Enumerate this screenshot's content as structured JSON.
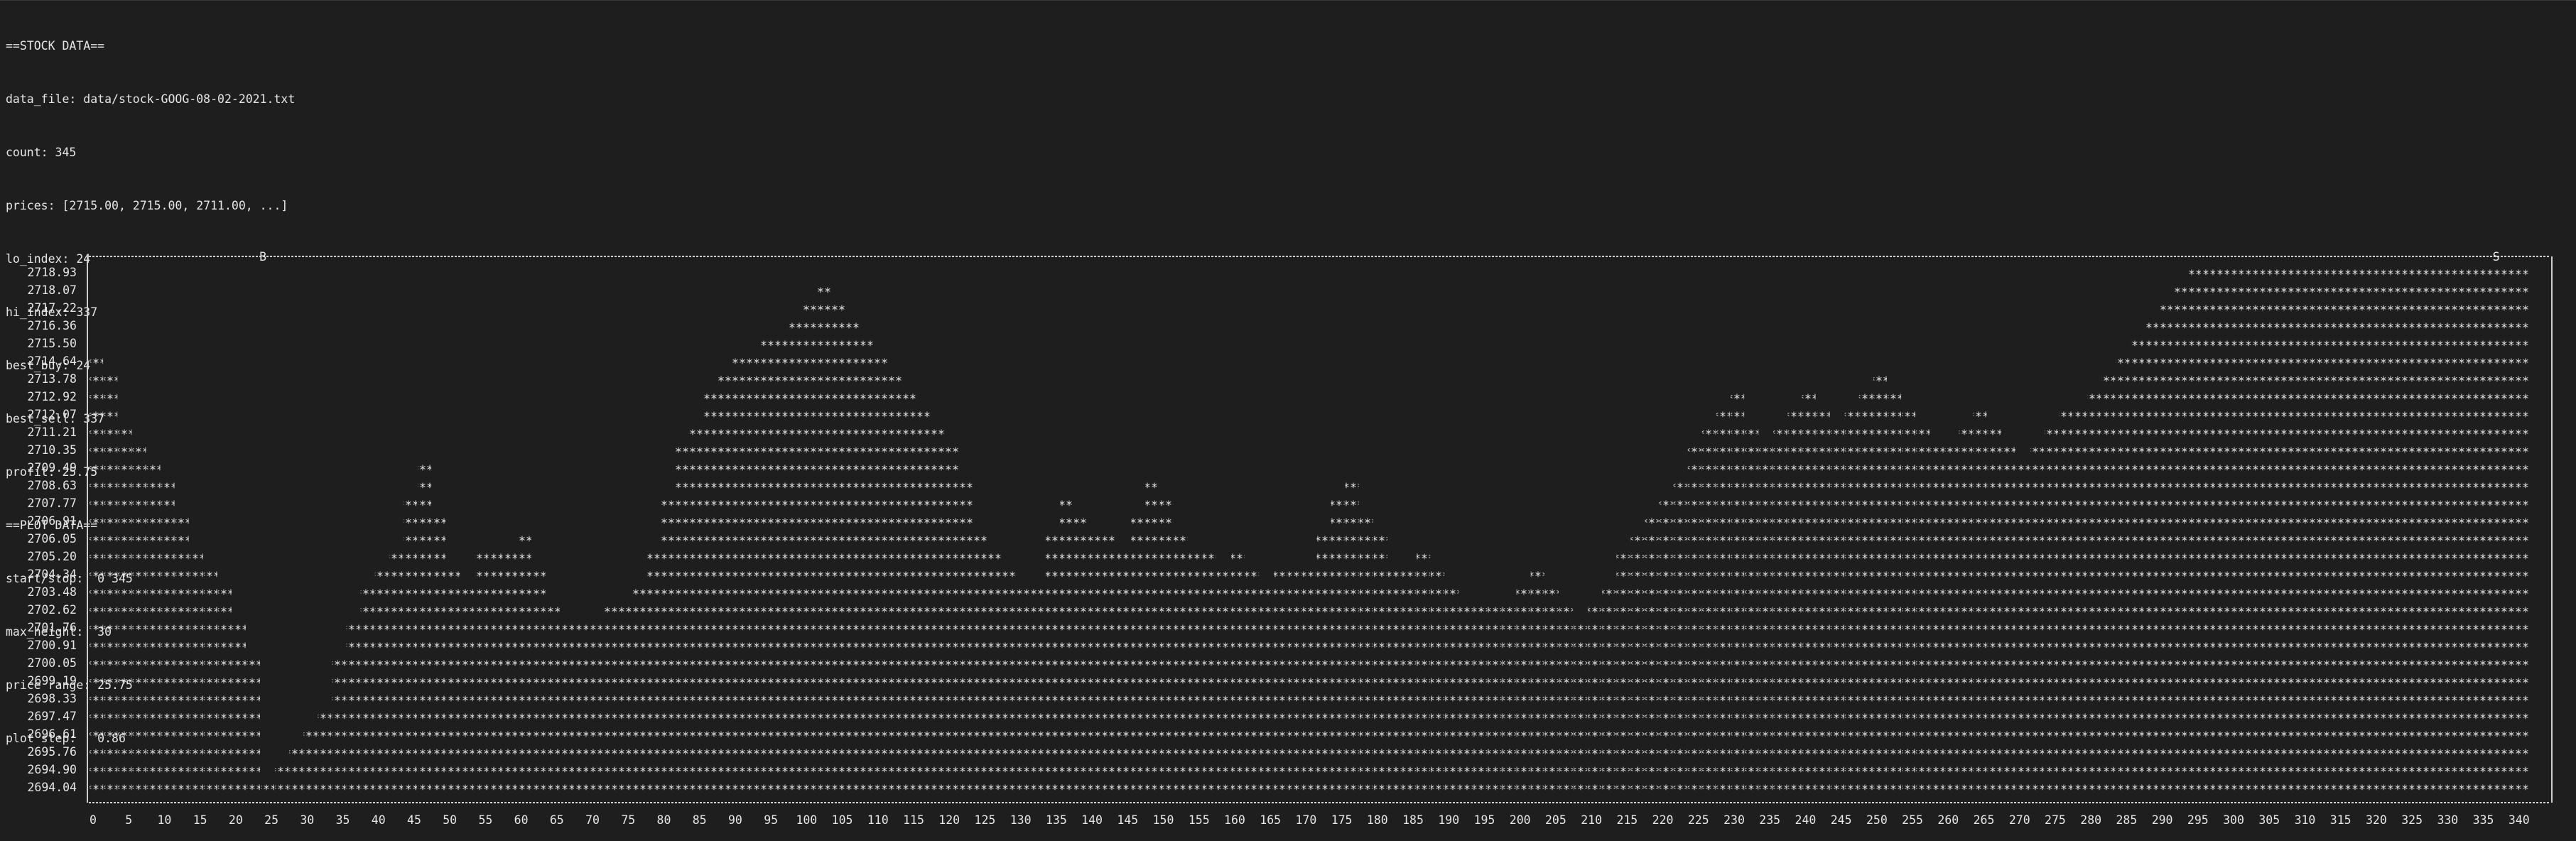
{
  "terminal": {
    "header_lines": [
      "==STOCK DATA==",
      "data_file: data/stock-GOOG-08-02-2021.txt",
      "count: 345",
      "prices: [2715.00, 2715.00, 2711.00, ...]",
      "lo_index: 24",
      "hi_index: 337",
      "best_buy: 24",
      "best_sell: 337",
      "profit: 25.75",
      "==PLOT DATA==",
      "start/stop:  0 345",
      "max_height:  30",
      "price range: 25.75",
      "plot step:   0.86"
    ]
  },
  "chart_data": {
    "type": "area",
    "title": "",
    "xlabel": "",
    "ylabel": "",
    "buy_marker": "B",
    "sell_marker": "S",
    "buy_index": 24,
    "sell_index": 337,
    "fill_char": "*",
    "y_tick_labels": [
      "2718.93",
      "2718.07",
      "2717.22",
      "2716.36",
      "2715.50",
      "2714.64",
      "2713.78",
      "2712.92",
      "2712.07",
      "2711.21",
      "2710.35",
      "2709.49",
      "2708.63",
      "2707.77",
      "2706.91",
      "2706.05",
      "2705.20",
      "2704.34",
      "2703.48",
      "2702.62",
      "2701.76",
      "2700.91",
      "2700.05",
      "2699.19",
      "2698.33",
      "2697.47",
      "2696.61",
      "2695.76",
      "2694.90",
      "2694.04"
    ],
    "x_tick_labels": [
      "0",
      "5",
      "10",
      "15",
      "20",
      "25",
      "30",
      "35",
      "40",
      "45",
      "50",
      "55",
      "60",
      "65",
      "70",
      "75",
      "80",
      "85",
      "90",
      "95",
      "100",
      "105",
      "110",
      "115",
      "120",
      "125",
      "130",
      "135",
      "140",
      "145",
      "150",
      "155",
      "160",
      "165",
      "170",
      "175",
      "180",
      "185",
      "190",
      "195",
      "200",
      "205",
      "210",
      "215",
      "220",
      "225",
      "230",
      "235",
      "240",
      "245",
      "250",
      "255",
      "260",
      "265",
      "270",
      "275",
      "280",
      "285",
      "290",
      "295",
      "300",
      "305",
      "310",
      "315",
      "320",
      "325",
      "330",
      "335",
      "340"
    ],
    "xlim": [
      0,
      345
    ],
    "ylim": [
      2694.04,
      2718.93
    ],
    "x": [
      0,
      2,
      4,
      6,
      8,
      10,
      12,
      14,
      16,
      18,
      20,
      22,
      24,
      26,
      28,
      30,
      32,
      34,
      36,
      38,
      40,
      42,
      44,
      46,
      48,
      50,
      52,
      54,
      56,
      58,
      60,
      62,
      64,
      66,
      68,
      70,
      72,
      74,
      76,
      78,
      80,
      82,
      84,
      86,
      88,
      90,
      92,
      94,
      96,
      98,
      100,
      102,
      104,
      106,
      108,
      110,
      112,
      114,
      116,
      118,
      120,
      122,
      124,
      126,
      128,
      130,
      132,
      134,
      136,
      138,
      140,
      142,
      144,
      146,
      148,
      150,
      152,
      154,
      156,
      158,
      160,
      162,
      164,
      166,
      168,
      170,
      172,
      174,
      176,
      178,
      180,
      182,
      184,
      186,
      188,
      190,
      192,
      194,
      196,
      198,
      200,
      202,
      204,
      206,
      208,
      210,
      212,
      214,
      216,
      218,
      220,
      222,
      224,
      226,
      228,
      230,
      232,
      234,
      236,
      238,
      240,
      242,
      244,
      246,
      248,
      250,
      252,
      254,
      256,
      258,
      260,
      262,
      264,
      266,
      268,
      270,
      272,
      274,
      276,
      278,
      280,
      282,
      284,
      286,
      288,
      290,
      292,
      294,
      296,
      298,
      300,
      302,
      304,
      306,
      308,
      310,
      312,
      314,
      316,
      318,
      320,
      322,
      324,
      326,
      328,
      330,
      332,
      334,
      336,
      338,
      340,
      342,
      344
    ],
    "values": [
      2714.6,
      2713.8,
      2711.2,
      2710.4,
      2709.5,
      2708.6,
      2707.0,
      2705.2,
      2704.3,
      2703.5,
      2701.8,
      2700.1,
      2694.0,
      2694.9,
      2695.8,
      2696.6,
      2697.5,
      2700.1,
      2701.8,
      2703.5,
      2704.3,
      2705.2,
      2707.8,
      2709.5,
      2706.9,
      2704.3,
      2703.5,
      2705.2,
      2705.2,
      2705.2,
      2706.1,
      2704.3,
      2702.6,
      2701.8,
      2701.8,
      2701.8,
      2702.6,
      2702.6,
      2703.5,
      2705.2,
      2707.8,
      2710.4,
      2711.2,
      2712.9,
      2713.8,
      2714.6,
      2714.6,
      2715.5,
      2715.5,
      2716.4,
      2717.2,
      2718.1,
      2717.2,
      2716.4,
      2715.5,
      2714.6,
      2713.8,
      2712.9,
      2712.1,
      2711.2,
      2710.4,
      2708.6,
      2706.1,
      2705.2,
      2704.3,
      2703.5,
      2703.5,
      2706.1,
      2707.8,
      2707.0,
      2706.1,
      2706.1,
      2705.2,
      2706.9,
      2708.6,
      2707.8,
      2706.1,
      2705.2,
      2705.2,
      2704.3,
      2705.2,
      2704.3,
      2703.5,
      2704.3,
      2704.3,
      2704.3,
      2706.1,
      2707.8,
      2708.6,
      2707.0,
      2706.1,
      2704.3,
      2704.3,
      2705.2,
      2704.3,
      2703.5,
      2702.6,
      2702.6,
      2702.6,
      2702.6,
      2703.5,
      2704.3,
      2703.5,
      2702.6,
      2701.8,
      2702.6,
      2703.5,
      2705.2,
      2706.1,
      2707.0,
      2707.8,
      2708.6,
      2710.4,
      2711.2,
      2712.1,
      2712.9,
      2711.2,
      2710.4,
      2711.2,
      2712.1,
      2712.9,
      2712.1,
      2711.2,
      2712.1,
      2712.9,
      2713.8,
      2712.9,
      2712.1,
      2711.2,
      2710.4,
      2710.4,
      2711.2,
      2712.1,
      2711.2,
      2710.4,
      2709.5,
      2710.4,
      2711.2,
      2712.1,
      2712.1,
      2712.9,
      2713.8,
      2714.6,
      2715.5,
      2716.4,
      2717.2,
      2718.1,
      2718.9,
      2718.9,
      2718.9,
      2718.9,
      2718.9,
      2718.9,
      2718.9,
      2718.9,
      2718.9,
      2718.9,
      2718.9,
      2718.9,
      2718.9,
      2718.9,
      2718.9,
      2718.9,
      2718.9,
      2718.9,
      2718.9,
      2718.9,
      2718.9,
      2718.9,
      2718.9,
      2718.9
    ]
  }
}
